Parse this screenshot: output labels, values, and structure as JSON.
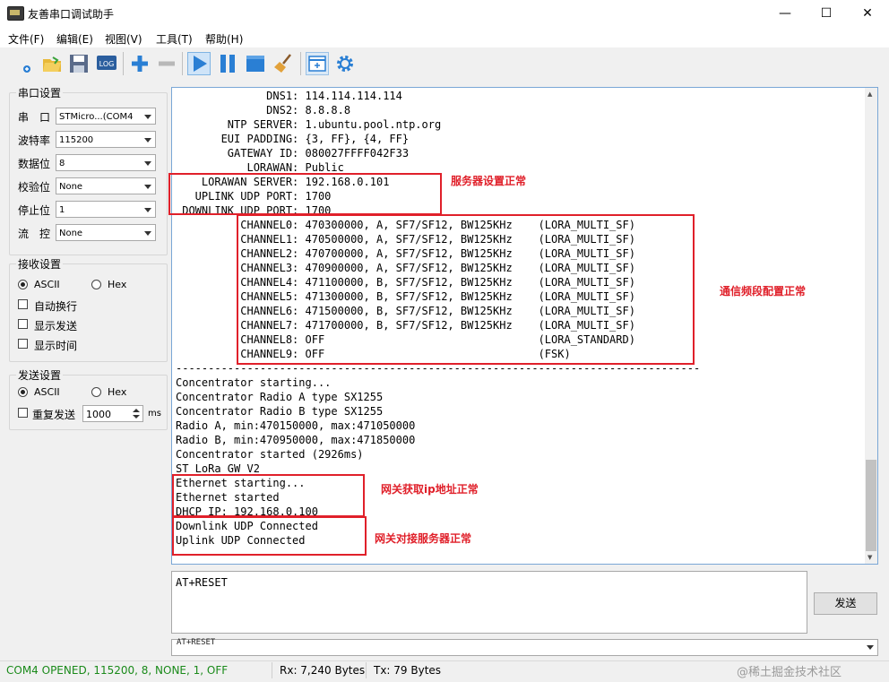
{
  "window": {
    "title": "友善串口调试助手",
    "min": "—",
    "max": "☐",
    "close": "✕"
  },
  "menu": [
    "文件(F)",
    "编辑(E)",
    "视图(V)",
    "工具(T)",
    "帮助(H)"
  ],
  "toolbar": {
    "log_label": "LOG"
  },
  "serial_settings": {
    "title": "串口设置",
    "port_label": "串　口",
    "port_value": "STMicro...(COM4",
    "baud_label": "波特率",
    "baud_value": "115200",
    "data_label": "数据位",
    "data_value": "8",
    "parity_label": "校验位",
    "parity_value": "None",
    "stop_label": "停止位",
    "stop_value": "1",
    "flow_label": "流　控",
    "flow_value": "None"
  },
  "receive_settings": {
    "title": "接收设置",
    "ascii": "ASCII",
    "hex": "Hex",
    "auto_wrap": "自动换行",
    "show_send": "显示发送",
    "show_time": "显示时间"
  },
  "send_settings": {
    "title": "发送设置",
    "ascii": "ASCII",
    "hex": "Hex",
    "repeat": "重复发送",
    "interval": "1000",
    "unit": "ms"
  },
  "terminal_lines": [
    "              DNS1: 114.114.114.114",
    "              DNS2: 8.8.8.8",
    "        NTP SERVER: 1.ubuntu.pool.ntp.org",
    "       EUI PADDING: {3, FF}, {4, FF}",
    "        GATEWAY ID: 080027FFFF042F33",
    "           LORAWAN: Public",
    "    LORAWAN SERVER: 192.168.0.101",
    "   UPLINK UDP PORT: 1700",
    " DOWNLINK UDP PORT: 1700",
    "          CHANNEL0: 470300000, A, SF7/SF12, BW125KHz    (LORA_MULTI_SF)",
    "          CHANNEL1: 470500000, A, SF7/SF12, BW125KHz    (LORA_MULTI_SF)",
    "          CHANNEL2: 470700000, A, SF7/SF12, BW125KHz    (LORA_MULTI_SF)",
    "          CHANNEL3: 470900000, A, SF7/SF12, BW125KHz    (LORA_MULTI_SF)",
    "          CHANNEL4: 471100000, B, SF7/SF12, BW125KHz    (LORA_MULTI_SF)",
    "          CHANNEL5: 471300000, B, SF7/SF12, BW125KHz    (LORA_MULTI_SF)",
    "          CHANNEL6: 471500000, B, SF7/SF12, BW125KHz    (LORA_MULTI_SF)",
    "          CHANNEL7: 471700000, B, SF7/SF12, BW125KHz    (LORA_MULTI_SF)",
    "          CHANNEL8: OFF                                 (LORA_STANDARD)",
    "          CHANNEL9: OFF                                 (FSK)",
    "---------------------------------------------------------------------------------",
    "Concentrator starting...",
    "Concentrator Radio A type SX1255",
    "Concentrator Radio B type SX1255",
    "Radio A, min:470150000, max:471050000",
    "Radio B, min:470950000, max:471850000",
    "Concentrator started (2926ms)",
    "ST LoRa GW V2",
    "Ethernet starting...",
    "Ethernet started",
    "DHCP IP: 192.168.0.100",
    "Downlink UDP Connected",
    "Uplink UDP Connected"
  ],
  "annotations": {
    "server_ok": "服务器设置正常",
    "channel_ok": "通信频段配置正常",
    "ip_ok": "网关获取ip地址正常",
    "connect_ok": "网关对接服务器正常"
  },
  "send": {
    "text": "AT+RESET",
    "button": "发送",
    "history": "AT+RESET"
  },
  "status": {
    "port": "COM4 OPENED, 115200, 8, NONE, 1, OFF",
    "rx": "Rx: 7,240 Bytes",
    "tx": "Tx: 79 Bytes",
    "watermark": "@稀土掘金技术社区"
  },
  "colors": {
    "status_ok": "#1a8a1a",
    "annotation_red": "#e0202a",
    "toolbar_blue": "#2a7fd4"
  }
}
